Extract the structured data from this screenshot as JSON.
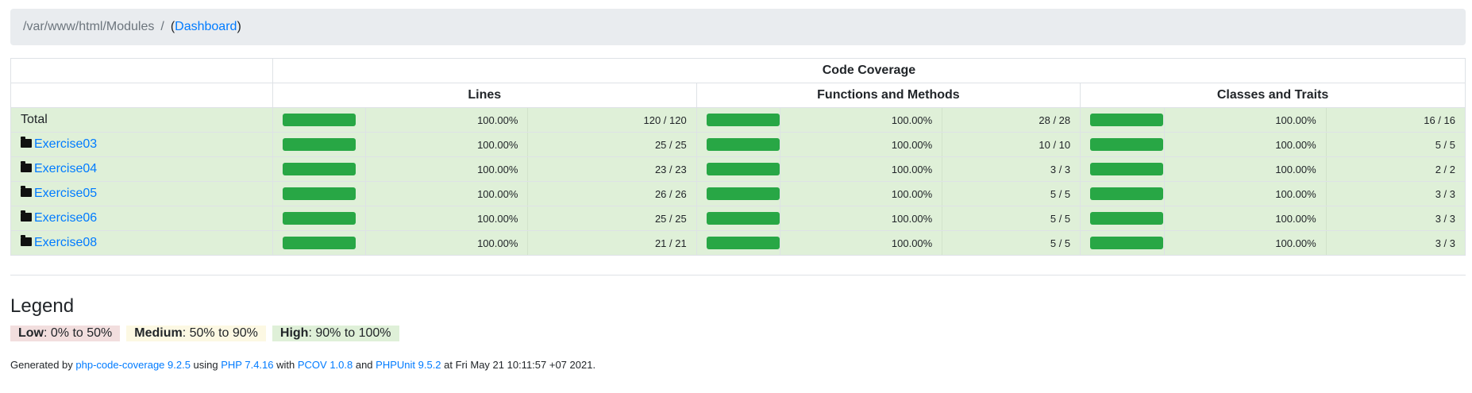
{
  "breadcrumb": {
    "path": "/var/www/html/Modules",
    "separator": "/",
    "open_paren": "(",
    "link": "Dashboard",
    "close_paren": ")"
  },
  "table": {
    "header_main": "Code Coverage",
    "columns": [
      "Lines",
      "Functions and Methods",
      "Classes and Traits"
    ],
    "rows": [
      {
        "name": "Total",
        "is_folder": false,
        "lines": {
          "pct": "100.00%",
          "ratio": "120 / 120",
          "fill": 1.0
        },
        "functions": {
          "pct": "100.00%",
          "ratio": "28 / 28",
          "fill": 1.0
        },
        "classes": {
          "pct": "100.00%",
          "ratio": "16 / 16",
          "fill": 1.0
        }
      },
      {
        "name": "Exercise03",
        "is_folder": true,
        "lines": {
          "pct": "100.00%",
          "ratio": "25 / 25",
          "fill": 1.0
        },
        "functions": {
          "pct": "100.00%",
          "ratio": "10 / 10",
          "fill": 1.0
        },
        "classes": {
          "pct": "100.00%",
          "ratio": "5 / 5",
          "fill": 1.0
        }
      },
      {
        "name": "Exercise04",
        "is_folder": true,
        "lines": {
          "pct": "100.00%",
          "ratio": "23 / 23",
          "fill": 1.0
        },
        "functions": {
          "pct": "100.00%",
          "ratio": "3 / 3",
          "fill": 1.0
        },
        "classes": {
          "pct": "100.00%",
          "ratio": "2 / 2",
          "fill": 1.0
        }
      },
      {
        "name": "Exercise05",
        "is_folder": true,
        "lines": {
          "pct": "100.00%",
          "ratio": "26 / 26",
          "fill": 1.0
        },
        "functions": {
          "pct": "100.00%",
          "ratio": "5 / 5",
          "fill": 1.0
        },
        "classes": {
          "pct": "100.00%",
          "ratio": "3 / 3",
          "fill": 1.0
        }
      },
      {
        "name": "Exercise06",
        "is_folder": true,
        "lines": {
          "pct": "100.00%",
          "ratio": "25 / 25",
          "fill": 1.0
        },
        "functions": {
          "pct": "100.00%",
          "ratio": "5 / 5",
          "fill": 1.0
        },
        "classes": {
          "pct": "100.00%",
          "ratio": "3 / 3",
          "fill": 1.0
        }
      },
      {
        "name": "Exercise08",
        "is_folder": true,
        "lines": {
          "pct": "100.00%",
          "ratio": "21 / 21",
          "fill": 1.0
        },
        "functions": {
          "pct": "100.00%",
          "ratio": "5 / 5",
          "fill": 1.0
        },
        "classes": {
          "pct": "100.00%",
          "ratio": "3 / 3",
          "fill": 1.0
        }
      }
    ]
  },
  "legend": {
    "title": "Legend",
    "low_label": "Low",
    "low_range": ": 0% to 50%",
    "medium_label": "Medium",
    "medium_range": ": 50% to 90%",
    "high_label": "High",
    "high_range": ": 90% to 100%"
  },
  "footer": {
    "generated_by": "Generated by ",
    "tool": "php-code-coverage 9.2.5",
    "using": " using ",
    "php": "PHP 7.4.16",
    "with": " with ",
    "pcov": "PCOV 1.0.8",
    "and": " and ",
    "phpunit": "PHPUnit 9.5.2",
    "at": " at Fri May 21 10:11:57 +07 2021."
  },
  "colors": {
    "bar_success": "#28a745",
    "row_success_bg": "#dff0d8",
    "link": "#007bff",
    "breadcrumb_bg": "#e9ecef",
    "legend_low": "#f2dede",
    "legend_medium": "#fcf8e3",
    "legend_high": "#dff0d8"
  },
  "icons": {
    "folder": "folder-icon"
  }
}
